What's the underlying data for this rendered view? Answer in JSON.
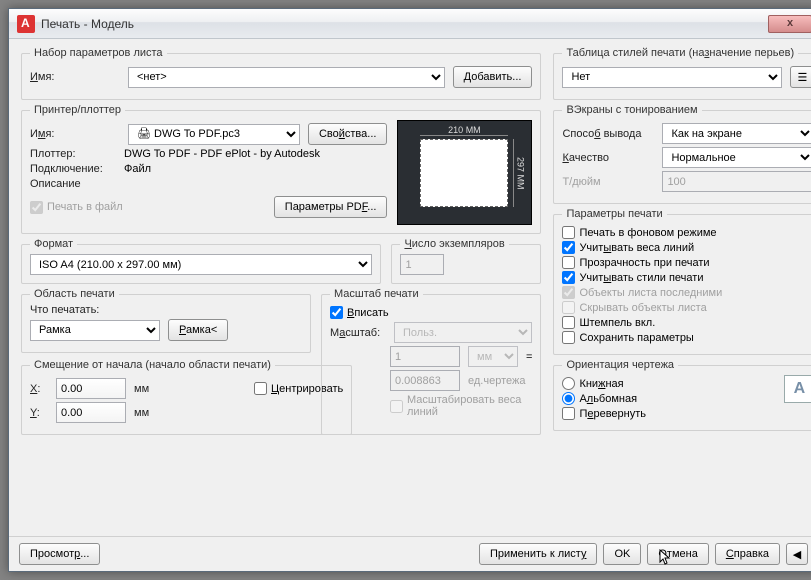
{
  "window": {
    "title": "Печать - Модель",
    "close": "x"
  },
  "pageSetup": {
    "title": "Набор параметров листа",
    "nameLabel": "Имя:",
    "nameValue": "<нет>",
    "addBtn": "Добавить..."
  },
  "printer": {
    "title": "Принтер/плоттер",
    "nameLabel": "Имя:",
    "nameValue": "DWG To PDF.pc3",
    "propsBtn": "Свойства...",
    "plotterLabel": "Плоттер:",
    "plotterValue": "DWG To PDF - PDF ePlot - by Autodesk",
    "portLabel": "Подключение:",
    "portValue": "Файл",
    "descLabel": "Описание",
    "printToFile": "Печать в файл",
    "pdfParamsBtn": "Параметры PDF...",
    "previewW": "210 MM",
    "previewH": "297 MM"
  },
  "paper": {
    "title": "Формат",
    "value": "ISO A4 (210.00 x 297.00 мм)"
  },
  "copies": {
    "title": "Число экземпляров",
    "value": "1"
  },
  "area": {
    "title": "Область печати",
    "whatLabel": "Что печатать:",
    "whatValue": "Рамка",
    "windowBtn": "Рамка<"
  },
  "offset": {
    "title": "Смещение от начала (начало области печати)",
    "xLabel": "X:",
    "xValue": "0.00",
    "unitX": "мм",
    "yLabel": "Y:",
    "yValue": "0.00",
    "unitY": "мм",
    "center": "Центрировать"
  },
  "scale": {
    "title": "Масштаб печати",
    "fit": "Вписать",
    "scaleLabel": "Масштаб:",
    "scaleValue": "Польз.",
    "numVal": "1",
    "unit": "мм",
    "eq": "=",
    "denVal": "0.008863",
    "denUnit": "ед.чертежа",
    "scaleLw": "Масштабировать веса линий"
  },
  "styleTable": {
    "title": "Таблица стилей печати (назначение перьев)",
    "value": "Нет"
  },
  "shade": {
    "title": "ВЭкраны с тонированием",
    "methodLabel": "Способ вывода",
    "methodValue": "Как на экране",
    "qualityLabel": "Качество",
    "qualityValue": "Нормальное",
    "dpiLabel": "Т/дюйм",
    "dpiValue": "100"
  },
  "options": {
    "title": "Параметры печати",
    "bg": "Печать в фоновом режиме",
    "lw": "Учитывать веса линий",
    "transp": "Прозрачность при печати",
    "styles": "Учитывать стили печати",
    "paperspaceLast": "Объекты листа последними",
    "hidePs": "Скрывать объекты листа",
    "stampOn": "Штемпель вкл.",
    "saveChanges": "Сохранить параметры"
  },
  "orient": {
    "title": "Ориентация чертежа",
    "portrait": "Книжная",
    "landscape": "Альбомная",
    "upside": "Перевернуть"
  },
  "footer": {
    "preview": "Просмотр...",
    "apply": "Применить к листу",
    "ok": "OK",
    "cancel": "Отмена",
    "help": "Справка"
  }
}
